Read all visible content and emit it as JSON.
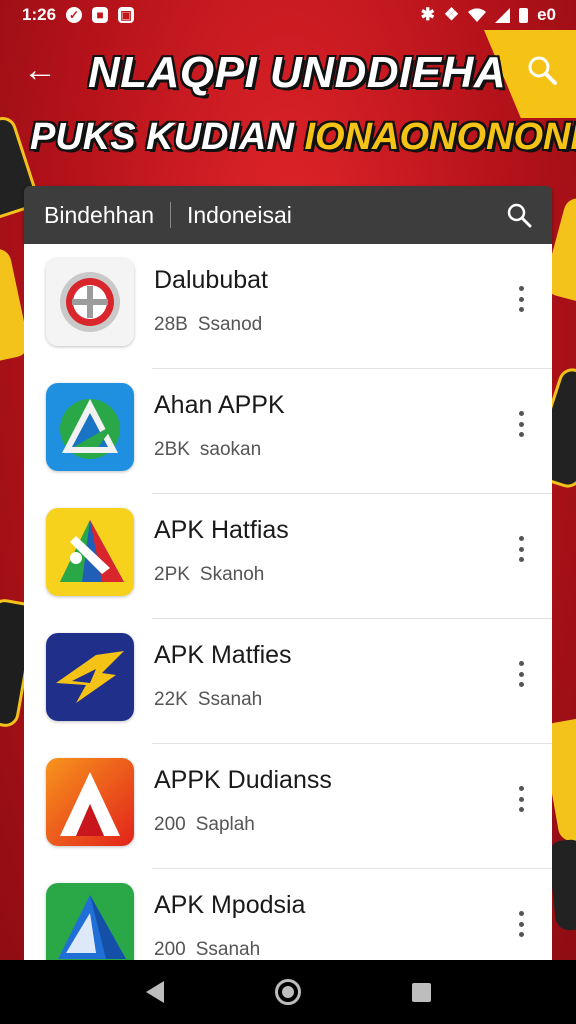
{
  "status_bar": {
    "time": "1:26",
    "battery_text": "e0"
  },
  "header": {
    "title_line1": "NLAQPI UNDDIEHA",
    "title_line2_white": "PUKS KUDIAN",
    "title_line2_yellow": "IONAONONONI?",
    "colors": {
      "accent_yellow": "#f5c316",
      "background_red": "#c3161c"
    }
  },
  "search": {
    "tab_1": "Bindehhan",
    "tab_2": "Indoneisai"
  },
  "apps": [
    {
      "name": "Dalububat",
      "size": "28B",
      "time": "Ssanod",
      "icon": "shield-emblem-icon"
    },
    {
      "name": "Ahan APPK",
      "size": "2BK",
      "time": "saokan",
      "icon": "triangle-a-logo-icon"
    },
    {
      "name": "APK Hatfias",
      "size": "2PK",
      "time": "Skanoh",
      "icon": "flag-pyramid-icon"
    },
    {
      "name": "APK Matfies",
      "size": "22K",
      "time": "Ssanah",
      "icon": "winged-emblem-icon"
    },
    {
      "name": "APPK Dudianss",
      "size": "200",
      "time": "Saplah",
      "icon": "orange-a-logo-icon"
    },
    {
      "name": "APK Mpodsia",
      "size": "200",
      "time": "Ssanah",
      "icon": "blue-triangle-logo-icon"
    }
  ]
}
